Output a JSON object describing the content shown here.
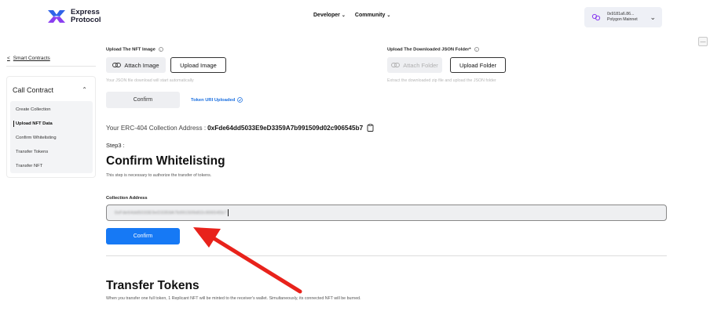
{
  "header": {
    "logo_line1": "Express",
    "logo_line2": "Protocol",
    "nav": [
      {
        "label": "Developer"
      },
      {
        "label": "Community"
      }
    ],
    "wallet": {
      "address": "0x9181a6.86...",
      "network": "Polygon Mainnet"
    }
  },
  "sidebar": {
    "back_label": "Smart Contracts",
    "section_title": "Call Contract",
    "items": [
      {
        "label": "Create Collection",
        "active": false
      },
      {
        "label": "Upload NFT Data",
        "active": true
      },
      {
        "label": "Confirm Whitelisting",
        "active": false
      },
      {
        "label": "Transfer Tokens",
        "active": false
      },
      {
        "label": "Transfer NFT",
        "active": false
      }
    ]
  },
  "upload": {
    "image_label": "Upload The NFT Image",
    "attach_image": "Attach Image",
    "upload_image": "Upload Image",
    "image_hint": "Your JSON file download will start automatically",
    "folder_label": "Upload The Downloaded JSON Folder*",
    "attach_folder": "Attach Folder",
    "upload_folder": "Upload Folder",
    "folder_hint": "Extract the downloaded zip file and upload the JSON folder",
    "confirm": "Confirm",
    "uploaded_status": "Token URI Uploaded"
  },
  "collection": {
    "prefix": "Your ERC-404 Collection Address :",
    "address": "0xFde64dd5033E9eD3359A7b991509d02c906545b7"
  },
  "whitelist": {
    "step": "Step3 :",
    "title": "Confirm Whitelisting",
    "subtitle": "This step is necessary to authorize the transfer of tokens.",
    "field_label": "Collection Address",
    "field_value": "0xFde64dd5033E9eD3359A7b991509d02c906545b7",
    "confirm": "Confirm"
  },
  "transfer": {
    "title": "Transfer Tokens",
    "subtitle": "When you transfer one full token, 1 Replicant NFT will be minted to the receiver's wallet. Simultaneously, its connected NFT will be burned."
  },
  "colors": {
    "primary_blue": "#1679f5",
    "annotation_red": "#e8221b",
    "logo_blue": "#2f63e8",
    "logo_purple": "#8b3ff0"
  }
}
